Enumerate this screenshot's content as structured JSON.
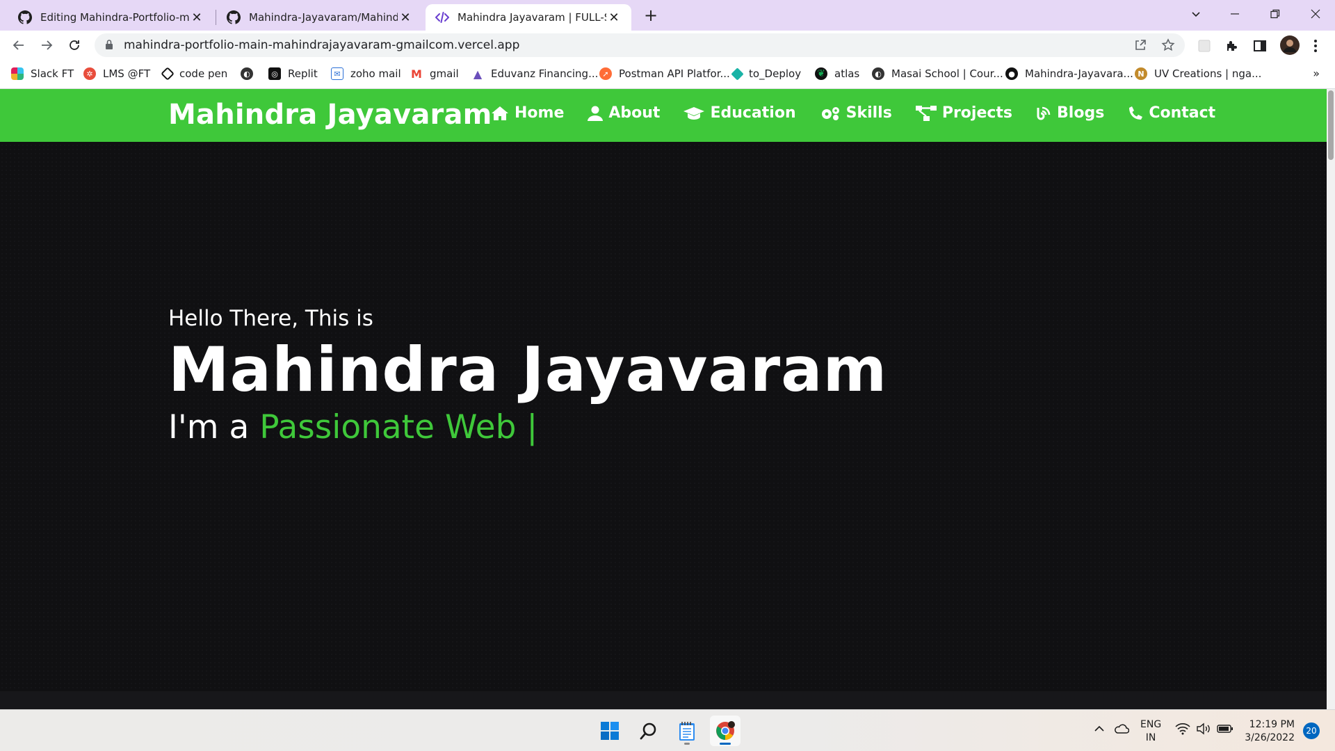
{
  "browser": {
    "tabs": [
      {
        "title": "Editing Mahindra-Portfolio-main/",
        "icon": "github-icon",
        "active": false
      },
      {
        "title": "Mahindra-Jayavaram/Mahindra-P",
        "icon": "github-icon",
        "active": false
      },
      {
        "title": "Mahindra Jayavaram | FULL-STAC",
        "icon": "code-icon",
        "active": true
      }
    ],
    "url": "mahindra-portfolio-main-mahindrajayavaram-gmailcom.vercel.app",
    "bookmarks": [
      {
        "label": "Slack FT",
        "icon": "slack-icon",
        "color": "#e01e5a"
      },
      {
        "label": "LMS @FT",
        "icon": "lms-icon",
        "color": "#e84d3c"
      },
      {
        "label": "code pen",
        "icon": "codepen-icon",
        "color": "#111111"
      },
      {
        "label": "",
        "icon": "globe-icon",
        "color": "#333333"
      },
      {
        "label": "Replit",
        "icon": "replit-icon",
        "color": "#111111"
      },
      {
        "label": "zoho mail",
        "icon": "mail-icon",
        "color": "#2a6fd6"
      },
      {
        "label": "gmail",
        "icon": "gmail-icon",
        "color": "#ea4335"
      },
      {
        "label": "Eduvanz Financing...",
        "icon": "eduvanz-icon",
        "color": "#6b4fbb"
      },
      {
        "label": "Postman API Platfor...",
        "icon": "postman-icon",
        "color": "#ff6c37"
      },
      {
        "label": "to_Deploy",
        "icon": "diamond-icon",
        "color": "#19b3a6"
      },
      {
        "label": "atlas",
        "icon": "leaf-icon",
        "color": "#13aa52"
      },
      {
        "label": "Masai School | Cour...",
        "icon": "globe-icon",
        "color": "#333333"
      },
      {
        "label": "Mahindra-Jayavara...",
        "icon": "github-icon",
        "color": "#111111"
      },
      {
        "label": "UV Creations | nga...",
        "icon": "uv-icon",
        "color": "#c28a2b"
      }
    ]
  },
  "site": {
    "brand": "Mahindra Jayavaram",
    "nav": [
      {
        "label": "Home",
        "icon": "home-icon"
      },
      {
        "label": "About",
        "icon": "user-icon"
      },
      {
        "label": "Education",
        "icon": "graduation-cap-icon"
      },
      {
        "label": "Skills",
        "icon": "gears-icon"
      },
      {
        "label": "Projects",
        "icon": "project-diagram-icon"
      },
      {
        "label": "Blogs",
        "icon": "blog-icon"
      },
      {
        "label": "Contact",
        "icon": "phone-icon"
      }
    ],
    "hero": {
      "greeting": "Hello There, This is",
      "name": "Mahindra Jayavaram",
      "prefix": "I'm a",
      "typed": "Passionate Web |"
    },
    "colors": {
      "accent": "#3fc83a",
      "background": "#101012"
    }
  },
  "taskbar": {
    "lang": {
      "line1": "ENG",
      "line2": "IN"
    },
    "time": "12:19 PM",
    "date": "3/26/2022",
    "notifications": "20"
  }
}
